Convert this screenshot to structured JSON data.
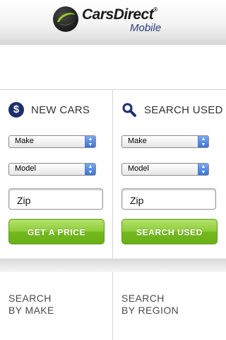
{
  "header": {
    "brand": "CarsDirect",
    "trademark": "®",
    "subtitle": "Mobile",
    "logo_icon": "carsdirect-swoosh-logo"
  },
  "new_cars": {
    "icon": "dollar-icon",
    "title": "NEW CARS",
    "make_select": "Make",
    "model_select": "Model",
    "zip_value": "Zip",
    "button_label": "GET A PRICE"
  },
  "used_cars": {
    "icon": "search-icon",
    "title": "SEARCH USED",
    "make_select": "Make",
    "model_select": "Model",
    "zip_value": "Zip",
    "button_label": "SEARCH USED"
  },
  "bottom": {
    "make_link": [
      "SEARCH",
      "BY MAKE"
    ],
    "region_link": [
      "SEARCH",
      "BY REGION"
    ]
  },
  "colors": {
    "accent_navy": "#1d2e6b",
    "button_green": "#8ccc37",
    "select_arrows_blue": "#3b72d9"
  }
}
